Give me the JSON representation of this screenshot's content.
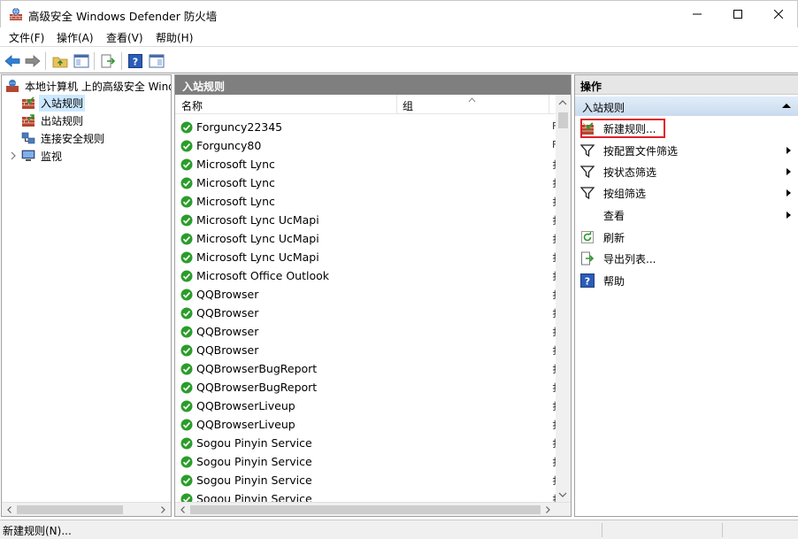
{
  "window": {
    "title": "高级安全 Windows Defender 防火墙",
    "app_icon": "firewall-icon"
  },
  "menu": [
    {
      "label": "文件(F)"
    },
    {
      "label": "操作(A)"
    },
    {
      "label": "查看(V)"
    },
    {
      "label": "帮助(H)"
    }
  ],
  "toolbar": {
    "icons": [
      "back-icon",
      "forward-icon",
      "up-folder-icon",
      "show-hide-tree-icon",
      "export-icon",
      "help-icon",
      "action-pane-icon"
    ]
  },
  "tree": {
    "root": "本地计算机 上的高级安全 Wind",
    "items": [
      {
        "label": "入站规则",
        "selected": true
      },
      {
        "label": "出站规则",
        "selected": false
      },
      {
        "label": "连接安全规则",
        "selected": false
      },
      {
        "label": "监视",
        "selected": false
      }
    ]
  },
  "center": {
    "header": "入站规则",
    "columns": [
      {
        "label": "名称"
      },
      {
        "label": "组"
      }
    ],
    "rows": [
      {
        "name": "Forguncy22345",
        "trail": "F"
      },
      {
        "name": "Forguncy80",
        "trail": "F"
      },
      {
        "name": "Microsoft Lync",
        "trail": "扌"
      },
      {
        "name": "Microsoft Lync",
        "trail": "扌"
      },
      {
        "name": "Microsoft Lync",
        "trail": "扌"
      },
      {
        "name": "Microsoft Lync UcMapi",
        "trail": "扌"
      },
      {
        "name": "Microsoft Lync UcMapi",
        "trail": "扌"
      },
      {
        "name": "Microsoft Lync UcMapi",
        "trail": "扌"
      },
      {
        "name": "Microsoft Office Outlook",
        "trail": "扌"
      },
      {
        "name": "QQBrowser",
        "trail": "扌"
      },
      {
        "name": "QQBrowser",
        "trail": "扌"
      },
      {
        "name": "QQBrowser",
        "trail": "扌"
      },
      {
        "name": "QQBrowser",
        "trail": "扌"
      },
      {
        "name": "QQBrowserBugReport",
        "trail": "扌"
      },
      {
        "name": "QQBrowserBugReport",
        "trail": "扌"
      },
      {
        "name": "QQBrowserLiveup",
        "trail": "扌"
      },
      {
        "name": "QQBrowserLiveup",
        "trail": "扌"
      },
      {
        "name": "Sogou Pinyin Service",
        "trail": "扌"
      },
      {
        "name": "Sogou Pinyin Service",
        "trail": "扌"
      },
      {
        "name": "Sogou Pinyin Service",
        "trail": "扌"
      },
      {
        "name": "Sogou Pinyin Service",
        "trail": "扌"
      }
    ]
  },
  "actions": {
    "title": "操作",
    "section": "入站规则",
    "items": [
      {
        "label": "新建规则...",
        "icon": "new-rule-icon",
        "submenu": false
      },
      {
        "label": "按配置文件筛选",
        "icon": "filter-icon",
        "submenu": true
      },
      {
        "label": "按状态筛选",
        "icon": "filter-icon",
        "submenu": true
      },
      {
        "label": "按组筛选",
        "icon": "filter-icon",
        "submenu": true
      },
      {
        "label": "查看",
        "icon": "",
        "submenu": true
      },
      {
        "label": "刷新",
        "icon": "refresh-icon",
        "submenu": false
      },
      {
        "label": "导出列表...",
        "icon": "export-list-icon",
        "submenu": false
      },
      {
        "label": "帮助",
        "icon": "help-icon",
        "submenu": false
      }
    ]
  },
  "status": {
    "text": "新建规则(N)..."
  },
  "colors": {
    "accent": "#e0202a",
    "selection": "#cce8ff",
    "header_gray": "#7f7f7f",
    "check_green": "#2a9d2a"
  }
}
